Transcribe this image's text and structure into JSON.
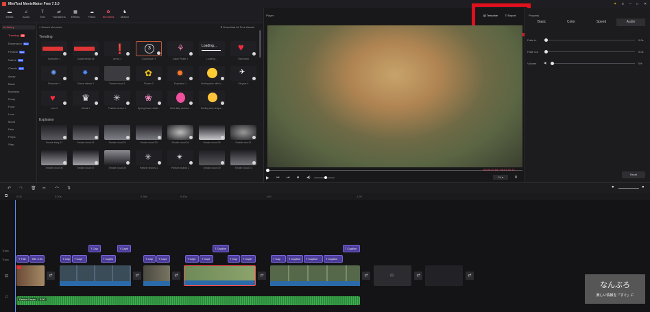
{
  "app": {
    "title": "MiniTool MovieMaker Free 7.5.0"
  },
  "toolbar": {
    "items": [
      {
        "label": "Media",
        "icon": "folder-icon"
      },
      {
        "label": "Audio",
        "icon": "music-icon"
      },
      {
        "label": "Text",
        "icon": "text-icon"
      },
      {
        "label": "Transitions",
        "icon": "transition-icon"
      },
      {
        "label": "Effects",
        "icon": "effects-icon"
      },
      {
        "label": "Filters",
        "icon": "filters-icon"
      },
      {
        "label": "Elements",
        "icon": "elements-icon"
      },
      {
        "label": "Motion",
        "icon": "motion-icon"
      }
    ]
  },
  "sidebar": {
    "header": "History",
    "search_placeholder": "Search elements",
    "download_all": "Download All Free Assets",
    "categories": [
      {
        "label": "Trending",
        "tag": "Hot"
      },
      {
        "label": "Expression",
        "tag": "New"
      },
      {
        "label": "Festival",
        "tag": "New"
      },
      {
        "label": "Nature",
        "tag": "New"
      },
      {
        "label": "Classic",
        "tag": "New"
      },
      {
        "label": "Arrow",
        "tag": ""
      },
      {
        "label": "Basic",
        "tag": ""
      },
      {
        "label": "Business",
        "tag": ""
      },
      {
        "label": "Emoji",
        "tag": ""
      },
      {
        "label": "Food",
        "tag": ""
      },
      {
        "label": "Love",
        "tag": ""
      },
      {
        "label": "Mood",
        "tag": ""
      },
      {
        "label": "Pets",
        "tag": ""
      },
      {
        "label": "Props",
        "tag": ""
      },
      {
        "label": "Step",
        "tag": ""
      }
    ]
  },
  "elements": {
    "trending_title": "Trending",
    "trending": [
      "Subscribe 1",
      "Social media 15",
      "Arrow 1",
      "Countdown 3",
      "Catch Pirate 1",
      "Loading...",
      "Red heart",
      "Fireworks 1",
      "Dance sticker 1",
      "Smoke cloud 1",
      "Flower 2",
      "Explosion 1",
      "Smiling face with h...",
      "Sk gear 4",
      "Love 2",
      "Medal 1",
      "Particle circles 2",
      "Spring flower sticki...",
      "Hello kitty women...",
      "Smiling face shape..."
    ],
    "explosion_title": "Explosion",
    "explosion": [
      "Smoke thing 01",
      "Smoke cloud 01",
      "Smoke cloud 02",
      "Smoke cloud 03",
      "Smoke cloud 04",
      "Smoke cloud 05",
      "Particle sbs 01",
      "Smoke cloud 06",
      "Smoke cloud 07",
      "Smoke cloud 08",
      "Particle shards 1",
      "Particle shards 2",
      "Smoke cloud 09",
      "Smoke cloud 10"
    ],
    "loading_text": "Loading..."
  },
  "player": {
    "label": "Player",
    "template_label": "Template",
    "export_label": "Export",
    "time": "00:00:19.18 / 00:01:32.12",
    "fit": "Fit"
  },
  "properties": {
    "label": "Property",
    "tabs": [
      "Basic",
      "Color",
      "Speed",
      "Audio"
    ],
    "rows": [
      {
        "label": "Fade in",
        "value": "0.0s"
      },
      {
        "label": "Fade out",
        "value": "0.0s"
      },
      {
        "label": "Volume",
        "value": "0%"
      }
    ],
    "reset_label": "Reset"
  },
  "timeline": {
    "ruler": [
      "0:00",
      "0:20s",
      "0:30s",
      "0:40s",
      "1:00",
      "1:20"
    ],
    "track_labels": [
      "Track",
      "Track"
    ],
    "text_clips_top": [
      "Cap",
      "Capti",
      "Caption",
      "Caption"
    ],
    "text_clips_bottom": [
      "Title",
      "Title 4:3s",
      "Cap",
      "Capt",
      "Cap",
      "Captio",
      "Cap",
      "Capt",
      "Capt",
      "Capt",
      "Cap",
      "Capti",
      "Capt",
      "Cap",
      "Captio",
      "Caption",
      "Caption",
      "Caption"
    ],
    "audio_label": "Defect Cases",
    "audio_duration": "5:50"
  },
  "watermark": {
    "title": "なんぶろ",
    "subtitle": "楽しい情報を「すぐ」に"
  },
  "colors": {
    "accent": "#ff5a6a",
    "text_clip": "#4b3c9a",
    "audio": "#2e8b3c",
    "highlight_box": "#e0101c"
  }
}
